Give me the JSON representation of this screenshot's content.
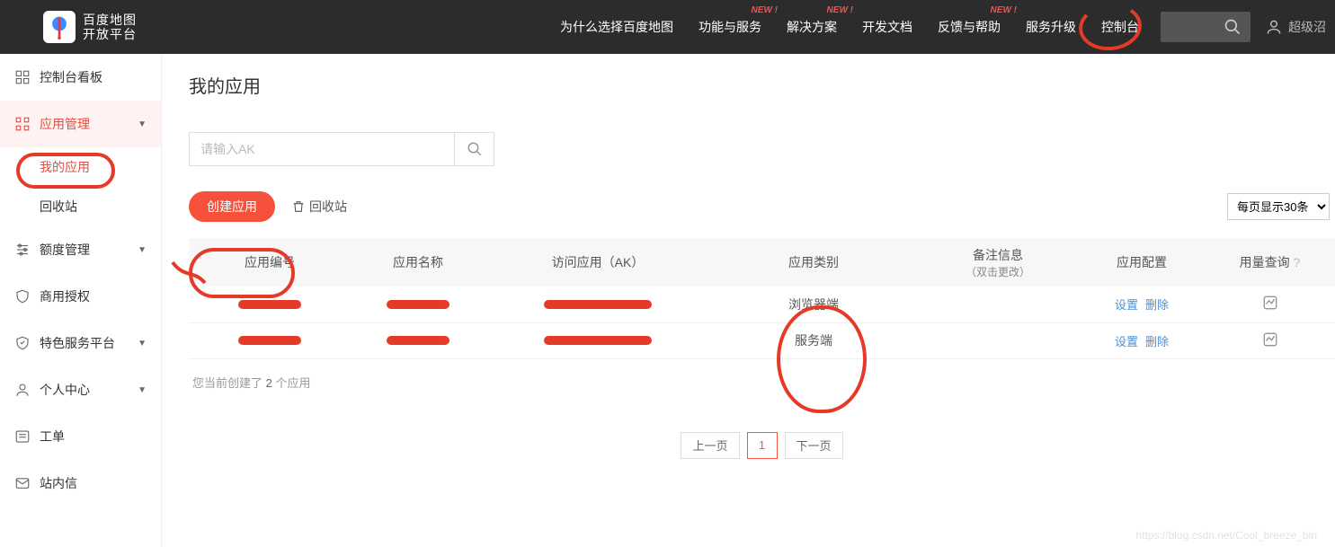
{
  "header": {
    "brand_line1": "百度地图",
    "brand_line2": "开放平台",
    "nav": [
      {
        "label": "为什么选择百度地图",
        "new": false
      },
      {
        "label": "功能与服务",
        "new": true
      },
      {
        "label": "解决方案",
        "new": true
      },
      {
        "label": "开发文档",
        "new": false
      },
      {
        "label": "反馈与帮助",
        "new": true
      },
      {
        "label": "服务升级",
        "new": false
      },
      {
        "label": "控制台",
        "new": false
      }
    ],
    "new_badge": "NEW !",
    "user_label": "超级沼"
  },
  "sidebar": {
    "items": [
      {
        "icon": "dashboard",
        "label": "控制台看板",
        "caret": false
      },
      {
        "icon": "apps",
        "label": "应用管理",
        "caret": true,
        "active": true,
        "subs": [
          {
            "label": "我的应用",
            "active": true
          },
          {
            "label": "回收站",
            "active": false
          }
        ]
      },
      {
        "icon": "sliders",
        "label": "额度管理",
        "caret": true
      },
      {
        "icon": "shield",
        "label": "商用授权",
        "caret": false
      },
      {
        "icon": "badge",
        "label": "特色服务平台",
        "caret": true
      },
      {
        "icon": "user",
        "label": "个人中心",
        "caret": true
      },
      {
        "icon": "ticket",
        "label": "工单",
        "caret": false
      },
      {
        "icon": "mail",
        "label": "站内信",
        "caret": false
      }
    ]
  },
  "main": {
    "title": "我的应用",
    "search_placeholder": "请输入AK",
    "create_label": "创建应用",
    "recycle_label": "回收站",
    "page_size_label": "每页显示30条",
    "columns": {
      "id": "应用编号",
      "name": "应用名称",
      "ak": "访问应用（AK）",
      "type": "应用类别",
      "remark": "备注信息",
      "remark_sub": "（双击更改）",
      "config": "应用配置",
      "usage": "用量查询"
    },
    "rows": [
      {
        "type": "浏览器端",
        "cfg_set": "设置",
        "cfg_del": "删除"
      },
      {
        "type": "服务端",
        "cfg_set": "设置",
        "cfg_del": "删除"
      }
    ],
    "summary_prefix": "您当前创建了 ",
    "summary_count": "2",
    "summary_suffix": " 个应用",
    "pager_prev": "上一页",
    "pager_cur": "1",
    "pager_next": "下一页",
    "watermark": "https://blog.csdn.net/Cool_breeze_bin"
  }
}
